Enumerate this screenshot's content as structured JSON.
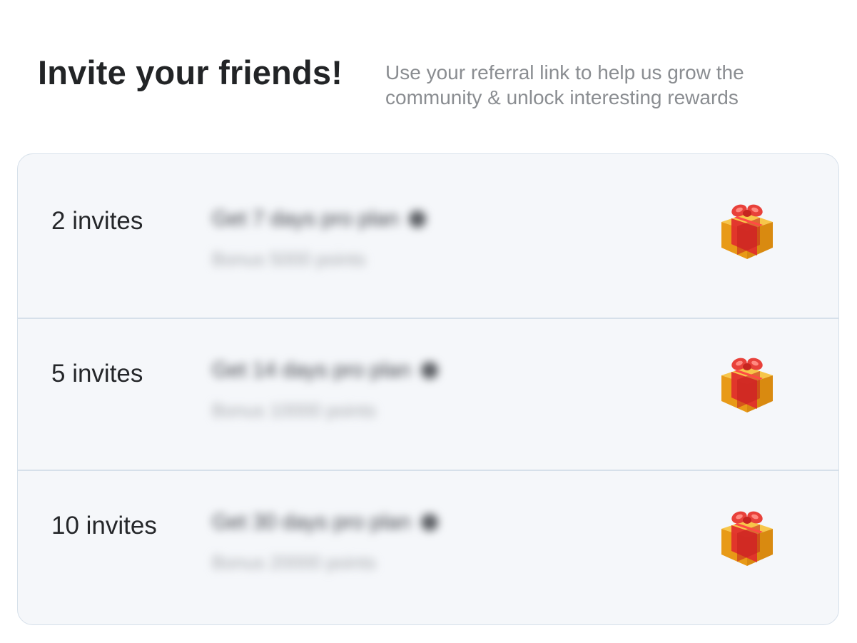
{
  "header": {
    "title": "Invite your friends!",
    "subtitle": "Use your referral link to help us grow the community & unlock interesting rewards"
  },
  "tiers": [
    {
      "count": "2 invites",
      "reward": "Get 7 days pro plan",
      "bonus": "Bonus 5000 points",
      "icon": "gift-icon"
    },
    {
      "count": "5 invites",
      "reward": "Get 14 days pro plan",
      "bonus": "Bonus 10000 points",
      "icon": "gift-icon"
    },
    {
      "count": "10 invites",
      "reward": "Get 30 days pro plan",
      "bonus": "Bonus 20000 points",
      "icon": "gift-icon"
    }
  ],
  "colors": {
    "title": "#222426",
    "subtitle": "#8a8d91",
    "card_background": "#f5f7fa",
    "card_border": "#d6e0ea",
    "gift_box": "#f0a91c",
    "gift_ribbon": "#e0302c"
  }
}
